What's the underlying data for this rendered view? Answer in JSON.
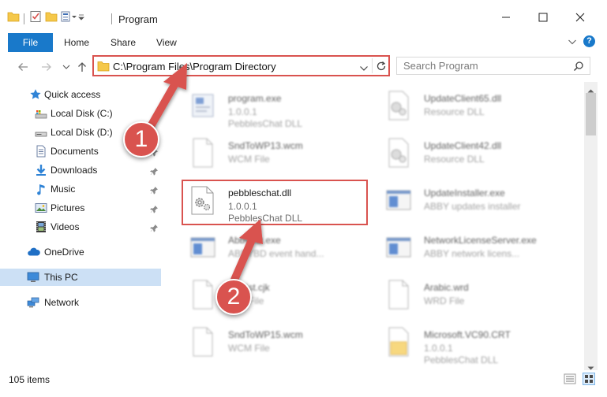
{
  "window": {
    "title": "Program"
  },
  "ribbon": {
    "tabs": [
      {
        "label": "File"
      },
      {
        "label": "Home"
      },
      {
        "label": "Share"
      },
      {
        "label": "View"
      }
    ]
  },
  "address": {
    "path": "C:\\Program Files\\Program Directory"
  },
  "search": {
    "placeholder": "Search Program"
  },
  "nav_pane": {
    "items": [
      {
        "label": "Quick access",
        "icon": "star-icon"
      },
      {
        "label": "Local Disk (C:)",
        "icon": "drive-icon"
      },
      {
        "label": "Local Disk (D:)",
        "icon": "drive-icon"
      },
      {
        "label": "Documents",
        "icon": "documents-icon",
        "pinned": true
      },
      {
        "label": "Downloads",
        "icon": "download-icon",
        "pinned": true
      },
      {
        "label": "Music",
        "icon": "music-icon",
        "pinned": true
      },
      {
        "label": "Pictures",
        "icon": "pictures-icon",
        "pinned": true
      },
      {
        "label": "Videos",
        "icon": "videos-icon",
        "pinned": true
      },
      {
        "label": "OneDrive",
        "icon": "cloud-icon"
      },
      {
        "label": "This PC",
        "icon": "computer-icon",
        "selected": true
      },
      {
        "label": "Network",
        "icon": "network-icon"
      }
    ]
  },
  "files": [
    {
      "name": "program.exe",
      "line2": "1.0.0.1",
      "line3": "PebblesChat DLL",
      "icon": "exe-icon"
    },
    {
      "name": "UpdateClient65.dll",
      "line2": "Resource DLL",
      "line3": "",
      "icon": "dll-icon"
    },
    {
      "name": "SndToWP13.wcm",
      "line2": "WCM File",
      "line3": "",
      "icon": "blank-file-icon"
    },
    {
      "name": "UpdateClient42.dll",
      "line2": "Resource DLL",
      "line3": "",
      "icon": "dll-icon"
    },
    {
      "name": "pebbleschat.dll",
      "line2": "1.0.0.1",
      "line3": "PebblesChat DLL",
      "icon": "dll-gear-icon"
    },
    {
      "name": "UpdateInstaller.exe",
      "line2": "ABBY updates installer",
      "line3": "",
      "icon": "window-icon"
    },
    {
      "name": "AbbyBD.exe",
      "line2": "ABBYBD event hand...",
      "line3": "",
      "icon": "window-icon"
    },
    {
      "name": "NetworkLicenseServer.exe",
      "line2": "ABBY network licens...",
      "line3": "",
      "icon": "window-icon"
    },
    {
      "name": "fontlist.cjk",
      "line2": "CJK File",
      "line3": "",
      "icon": "blank-file-icon"
    },
    {
      "name": "Arabic.wrd",
      "line2": "WRD File",
      "line3": "",
      "icon": "blank-file-icon"
    },
    {
      "name": "SndToWP15.wcm",
      "line2": "WCM File",
      "line3": "",
      "icon": "blank-file-icon"
    },
    {
      "name": "Microsoft.VC90.CRT",
      "line2": "1.0.0.1",
      "line3": "PebblesChat DLL",
      "icon": "folder-file-icon"
    }
  ],
  "status": {
    "item_count": "105 items"
  },
  "annotations": {
    "step1": "1",
    "step2": "2"
  },
  "colors": {
    "accent": "#1979ca",
    "annotation": "#d9534f",
    "selection": "#cce0f5"
  }
}
